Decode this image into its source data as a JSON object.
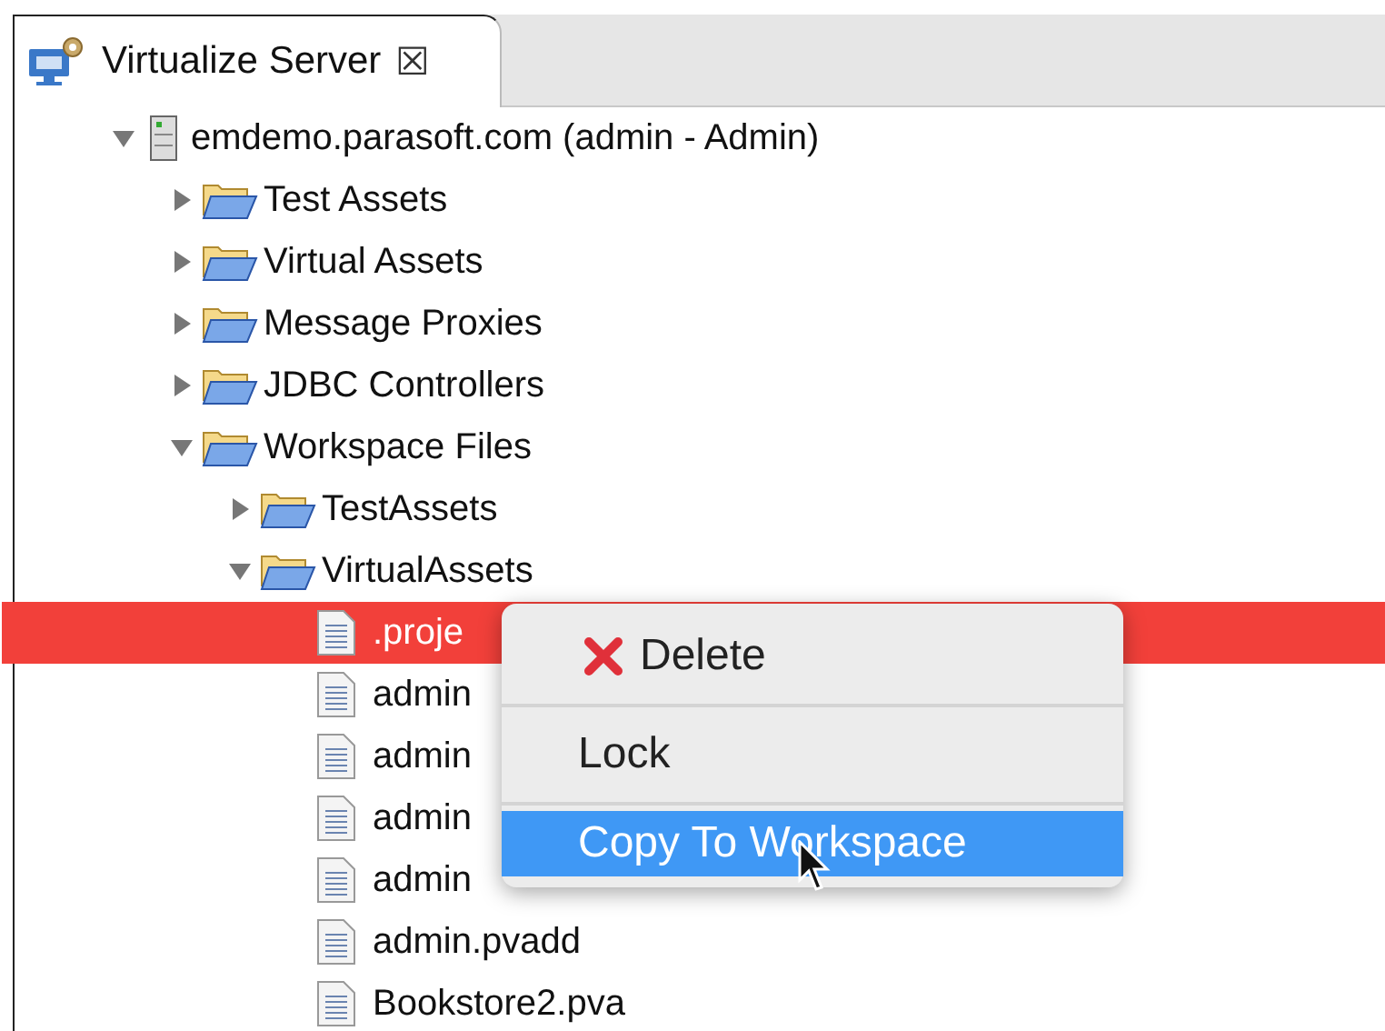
{
  "tabs": [
    {
      "title": "Virtualize Server",
      "close": "☒",
      "selected": true
    }
  ],
  "tree": [
    {
      "label": "emdemo.parasoft.com (admin - Admin)",
      "kind": "server",
      "expanded": true,
      "selected": false,
      "children": [
        {
          "label": "Test Assets",
          "kind": "folder",
          "expanded": false,
          "selected": false
        },
        {
          "label": "Virtual Assets",
          "kind": "folder",
          "expanded": false,
          "selected": false
        },
        {
          "label": "Message Proxies",
          "kind": "folder",
          "expanded": false,
          "selected": false
        },
        {
          "label": "JDBC Controllers",
          "kind": "folder",
          "expanded": false,
          "selected": false
        },
        {
          "label": "Workspace Files",
          "kind": "folder",
          "expanded": true,
          "selected": false,
          "children": [
            {
              "label": "TestAssets",
              "kind": "folder",
              "expanded": false,
              "selected": false
            },
            {
              "label": "VirtualAssets",
              "kind": "folder",
              "expanded": true,
              "selected": false,
              "children": [
                {
                  "label": ".proje",
                  "kind": "file",
                  "selected": true
                },
                {
                  "label": "admin",
                  "kind": "file",
                  "selected": false
                },
                {
                  "label": "admin",
                  "kind": "file",
                  "selected": false
                },
                {
                  "label": "admin",
                  "kind": "file",
                  "selected": false
                },
                {
                  "label": "admin",
                  "kind": "file",
                  "selected": false
                },
                {
                  "label": "admin.pvadd",
                  "kind": "file",
                  "selected": false
                },
                {
                  "label": "Bookstore2.pva",
                  "kind": "file",
                  "selected": false
                }
              ]
            }
          ]
        }
      ]
    }
  ],
  "context_menu": {
    "items": [
      {
        "label": "Delete",
        "kind": "delete",
        "selected": false
      },
      {
        "label": "Lock",
        "kind": "plain",
        "selected": false
      },
      {
        "label": "Copy To Workspace",
        "kind": "plain",
        "selected": true
      }
    ]
  }
}
